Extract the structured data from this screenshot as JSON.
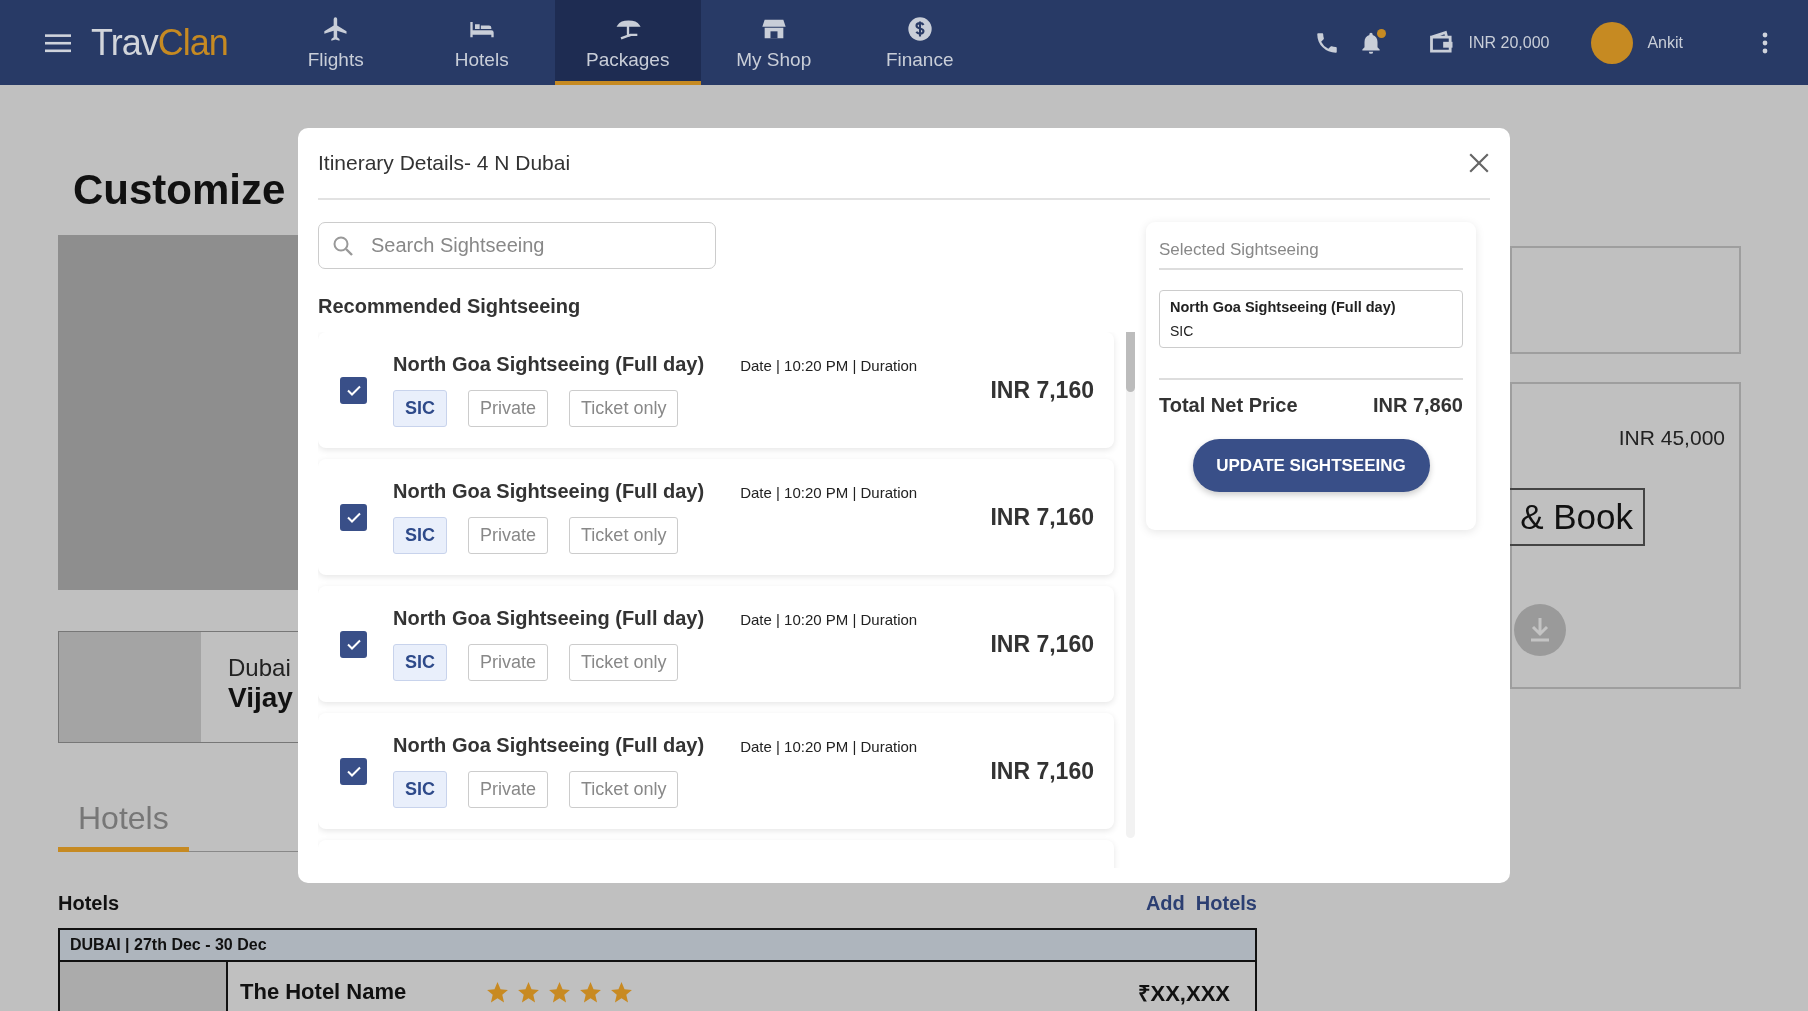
{
  "header": {
    "logo": {
      "part_1": "Trav",
      "part_2": "Clan"
    },
    "nav": [
      {
        "label": "Flights",
        "selected": false
      },
      {
        "label": "Hotels",
        "selected": false
      },
      {
        "label": "Packages",
        "selected": true
      },
      {
        "label": "My Shop",
        "selected": false
      },
      {
        "label": "Finance",
        "selected": false
      }
    ],
    "has_notification": true,
    "wallet_balance": "INR 20,000",
    "user_name": "Ankit"
  },
  "page": {
    "title": "Customize",
    "trip_card": {
      "city": "Dubai",
      "name": "Vijay"
    },
    "tabs": [
      {
        "label": "Hotels",
        "selected": true
      }
    ],
    "hotels_heading": "Hotels",
    "add_hotels_link": "Add  Hotels",
    "hotel_table": {
      "band": "DUBAI | 27th Dec - 30 Dec",
      "rows": [
        {
          "name": "The Hotel Name",
          "stars": 5,
          "price": "₹XX,XXX"
        }
      ]
    },
    "summary": {
      "price": "INR 45,000",
      "book_button": "& Book"
    }
  },
  "modal": {
    "title": "Itinerary Details- 4 N Dubai",
    "search": {
      "placeholder": "Search Sightseeing"
    },
    "section_heading": "Recommended Sightseeing",
    "items": [
      {
        "title": "North Goa Sightseeing (Full day)",
        "checked": true,
        "schedule": "Date | 10:20 PM | Duration",
        "price": "INR 7,160",
        "options": [
          {
            "label": "SIC",
            "selected": true
          },
          {
            "label": "Private",
            "selected": false
          },
          {
            "label": "Ticket only",
            "selected": false
          }
        ]
      },
      {
        "title": "North Goa Sightseeing (Full day)",
        "checked": true,
        "schedule": "Date | 10:20 PM | Duration",
        "price": "INR 7,160",
        "options": [
          {
            "label": "SIC",
            "selected": true
          },
          {
            "label": "Private",
            "selected": false
          },
          {
            "label": "Ticket only",
            "selected": false
          }
        ]
      },
      {
        "title": "North Goa Sightseeing (Full day)",
        "checked": true,
        "schedule": "Date | 10:20 PM | Duration",
        "price": "INR 7,160",
        "options": [
          {
            "label": "SIC",
            "selected": true
          },
          {
            "label": "Private",
            "selected": false
          },
          {
            "label": "Ticket only",
            "selected": false
          }
        ]
      },
      {
        "title": "North Goa Sightseeing (Full day)",
        "checked": true,
        "schedule": "Date | 10:20 PM | Duration",
        "price": "INR 7,160",
        "options": [
          {
            "label": "SIC",
            "selected": true
          },
          {
            "label": "Private",
            "selected": false
          },
          {
            "label": "Ticket only",
            "selected": false
          }
        ]
      }
    ],
    "selected_panel": {
      "heading": "Selected Sightseeing",
      "items": [
        {
          "title": "North Goa Sightseeing (Full day)",
          "option": "SIC"
        }
      ],
      "total_label": "Total Net Price",
      "total_value": "INR 7,860",
      "button": "UPDATE SIGHTSEEING"
    }
  }
}
